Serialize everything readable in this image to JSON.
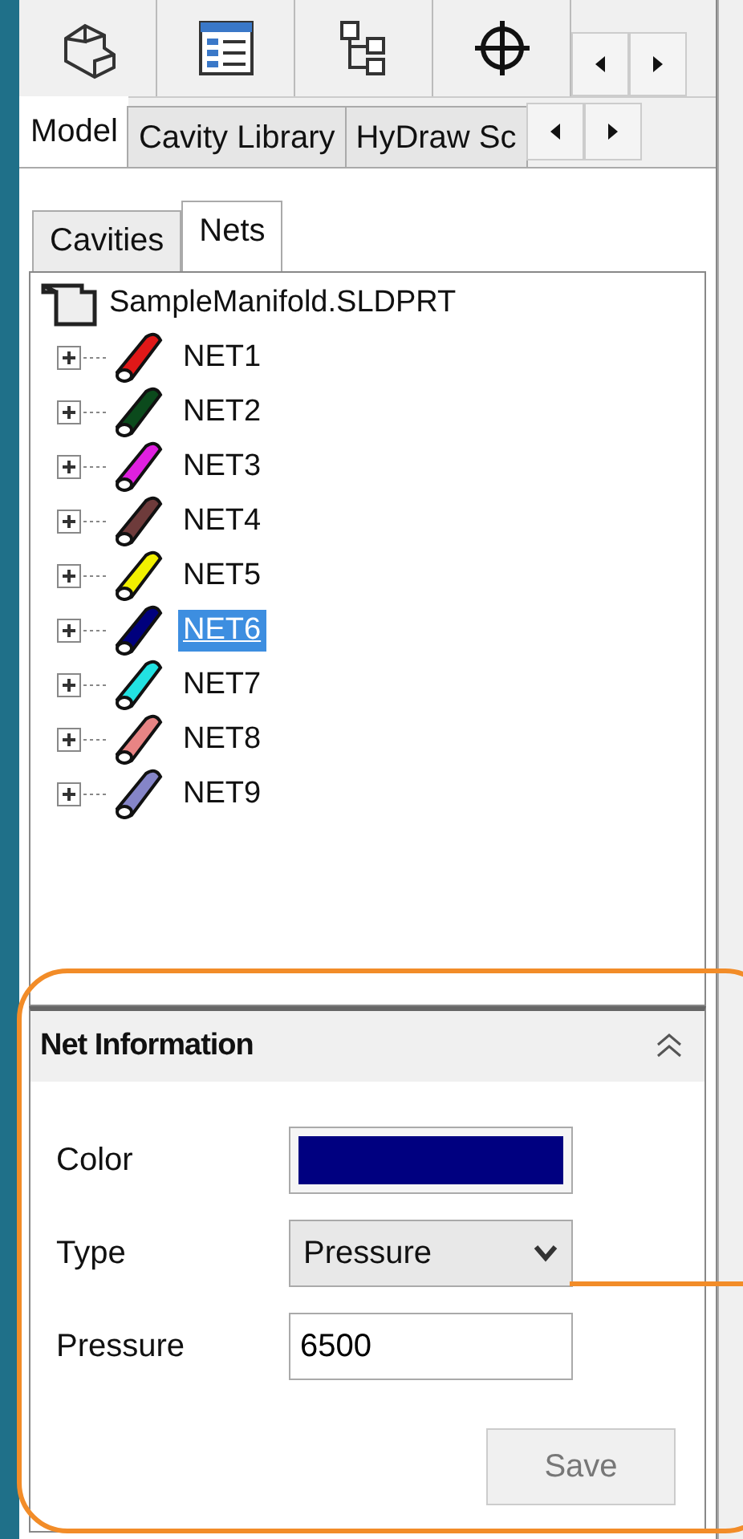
{
  "toolbar": {
    "icons": [
      {
        "kind": "part",
        "selected": false
      },
      {
        "kind": "list",
        "selected": false
      },
      {
        "kind": "hierarchy",
        "selected": false
      },
      {
        "kind": "crosshair",
        "selected": false
      }
    ]
  },
  "tabs": [
    {
      "label": "Model",
      "selected": true
    },
    {
      "label": "Cavity Library",
      "selected": false
    },
    {
      "label": "HyDraw Sc",
      "selected": false
    }
  ],
  "subtabs": [
    {
      "label": "Cavities",
      "selected": false
    },
    {
      "label": "Nets",
      "selected": true
    }
  ],
  "tree": {
    "root": "SampleManifold.SLDPRT",
    "children": [
      {
        "label": "NET1",
        "color": "#e01818",
        "selected": false,
        "expanded": false
      },
      {
        "label": "NET2",
        "color": "#0b4a1c",
        "selected": false,
        "expanded": false
      },
      {
        "label": "NET3",
        "color": "#e020e0",
        "selected": false,
        "expanded": false
      },
      {
        "label": "NET4",
        "color": "#6e3b3b",
        "selected": false,
        "expanded": false
      },
      {
        "label": "NET5",
        "color": "#f2f000",
        "selected": false,
        "expanded": false
      },
      {
        "label": "NET6",
        "color": "#00007d",
        "selected": true,
        "expanded": false
      },
      {
        "label": "NET7",
        "color": "#22e2e2",
        "selected": false,
        "expanded": false
      },
      {
        "label": "NET8",
        "color": "#e88484",
        "selected": false,
        "expanded": false
      },
      {
        "label": "NET9",
        "color": "#8585c8",
        "selected": false,
        "expanded": false
      }
    ]
  },
  "net_info": {
    "title": "Net Information",
    "expanded": true,
    "fields": [
      {
        "kind": "color",
        "label": "Color",
        "color": "#000080"
      },
      {
        "kind": "select",
        "label": "Type",
        "value": "Pressure"
      },
      {
        "kind": "text",
        "label": "Pressure",
        "value": "6500"
      }
    ],
    "save_button": {
      "label": "Save",
      "disabled": true
    }
  }
}
